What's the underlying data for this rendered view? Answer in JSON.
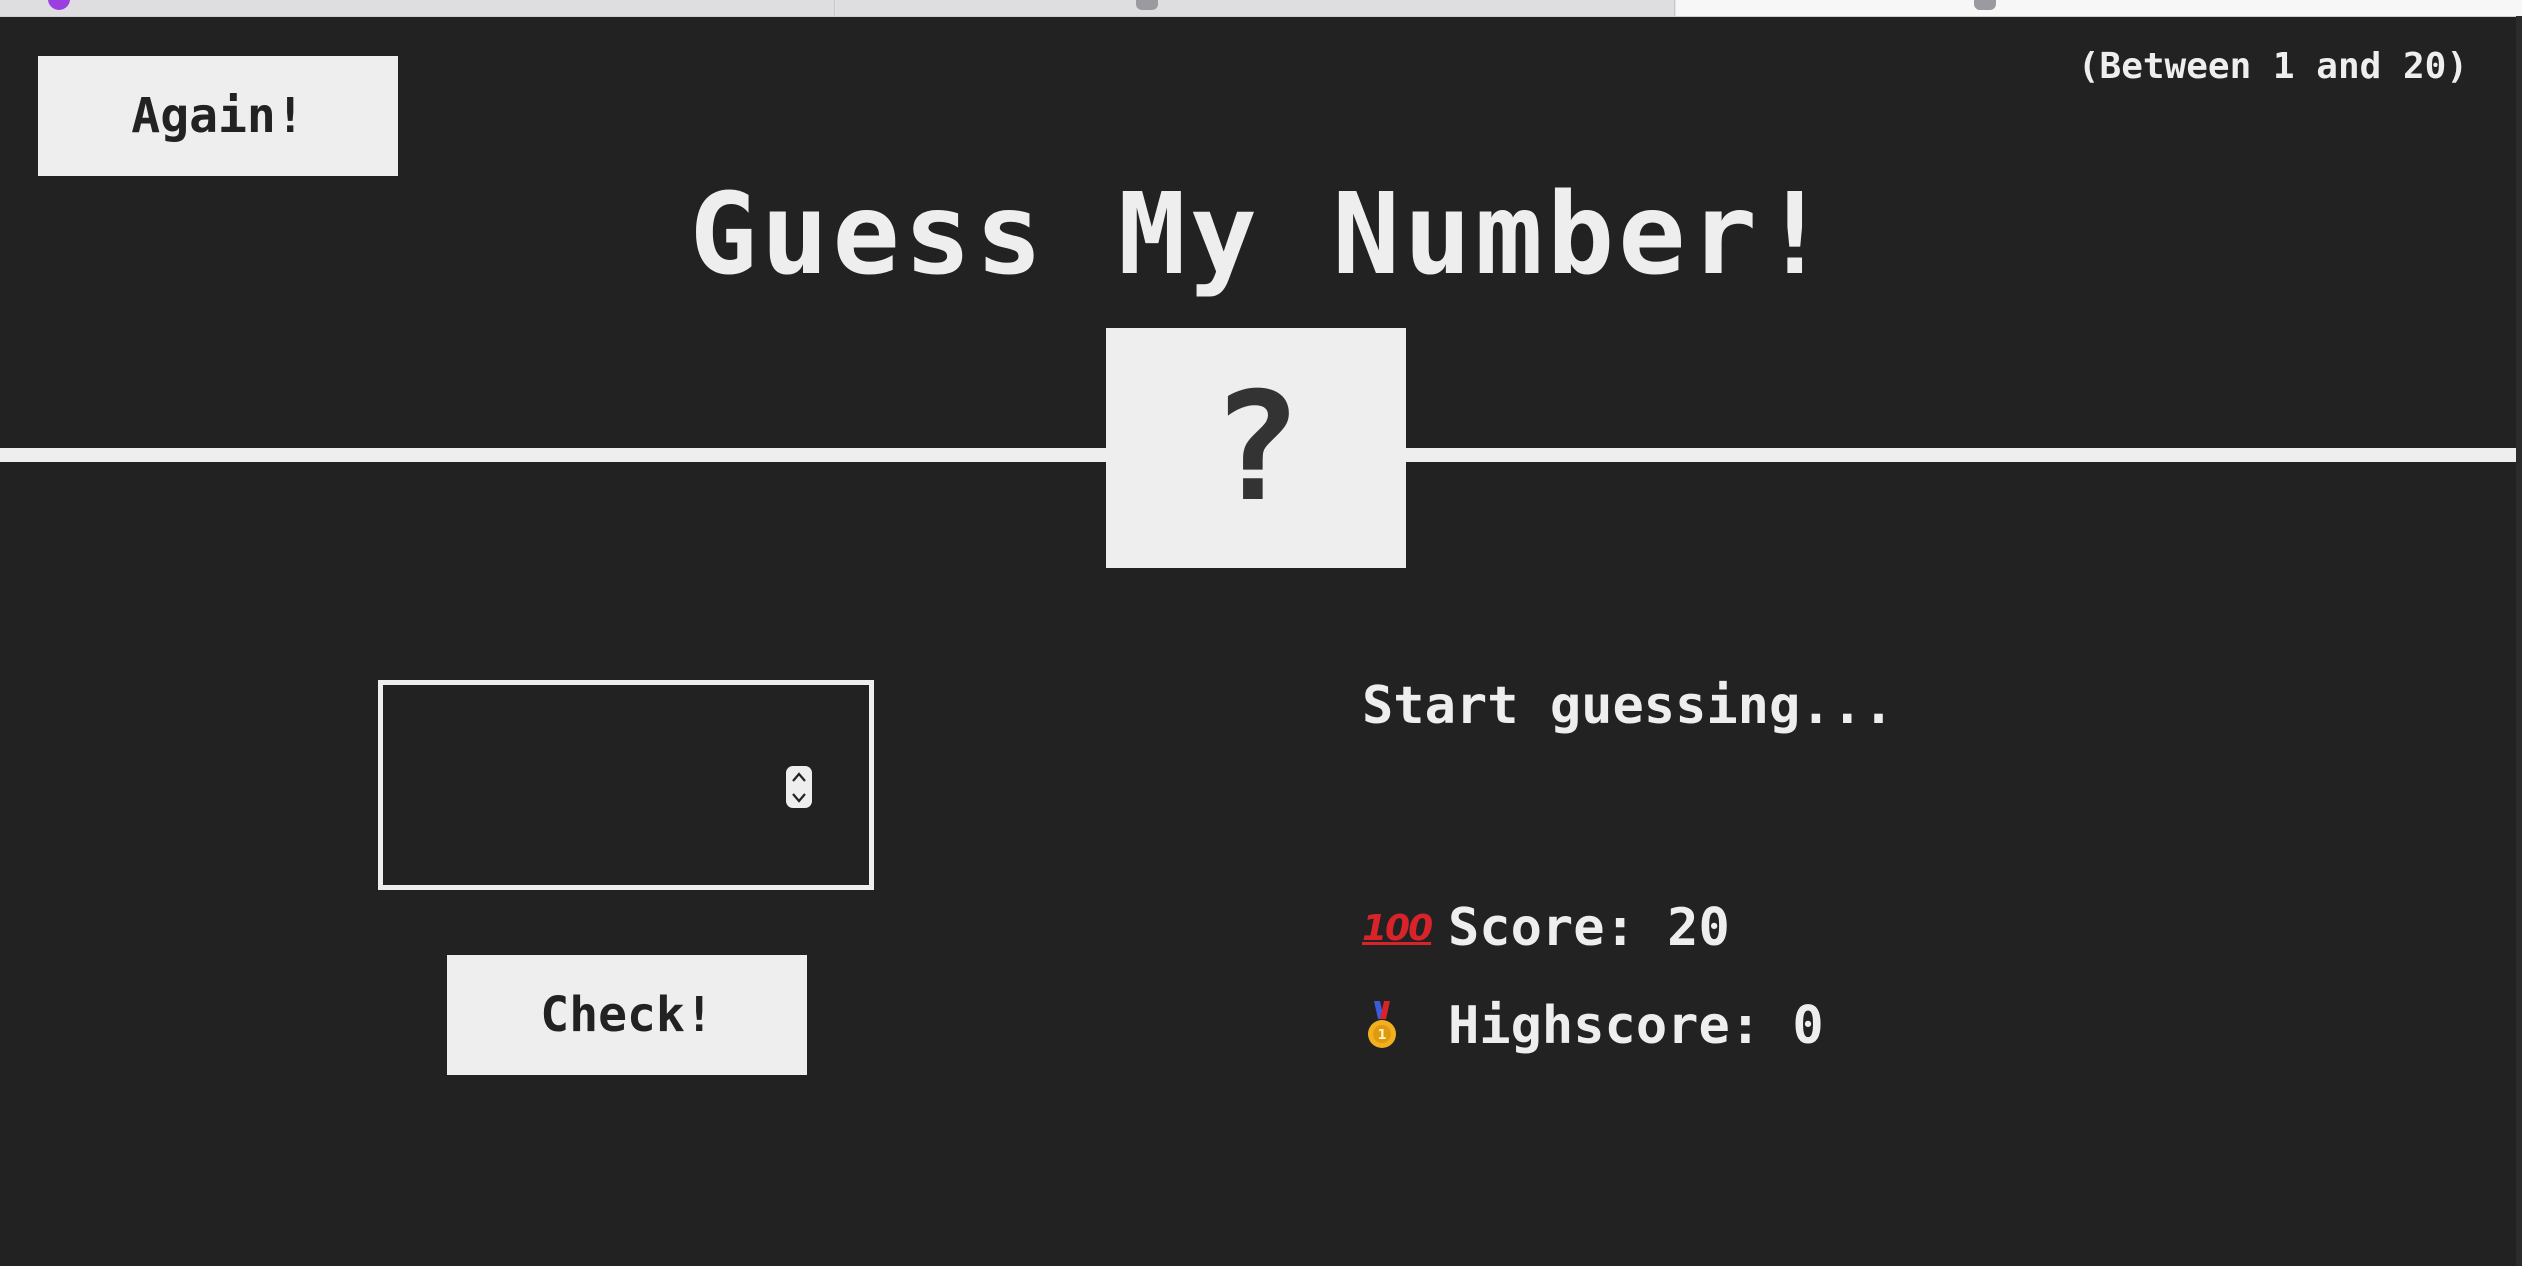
{
  "game": {
    "again_label": "Again!",
    "range_hint": "(Between 1 and 20)",
    "title": "Guess My Number!",
    "secret_display": "?",
    "guess_value": "",
    "check_label": "Check!",
    "message": "Start guessing...",
    "score_label": "Score: ",
    "score_value": "20",
    "highscore_label": "Highscore: ",
    "highscore_value": "0",
    "score_icon": "100-icon",
    "highscore_icon": "medal-icon"
  },
  "colors": {
    "background": "#222222",
    "foreground": "#eeeeee",
    "accent_red": "#d8232a",
    "medal_gold": "#f2b01e"
  }
}
